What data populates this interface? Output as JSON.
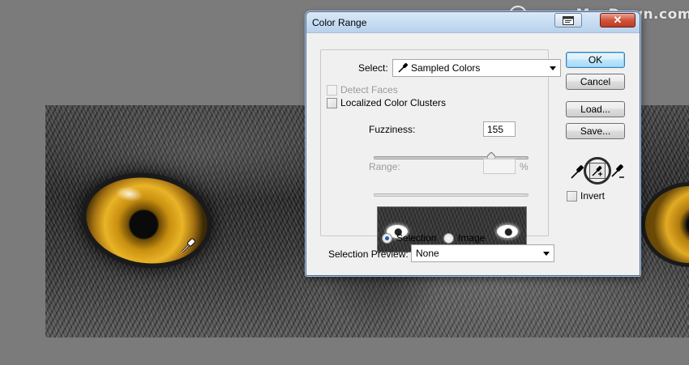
{
  "watermark": {
    "logo": "M",
    "text": "www.MacDown.com"
  },
  "dialog": {
    "title": "Color Range",
    "select": {
      "label": "Select:",
      "value": "Sampled Colors"
    },
    "detect_faces": {
      "label": "Detect Faces",
      "checked": false,
      "enabled": false
    },
    "localized_clusters": {
      "label": "Localized Color Clusters",
      "checked": false
    },
    "fuzziness": {
      "label": "Fuzziness:",
      "value": "155",
      "slider_fraction": 0.76
    },
    "range": {
      "label": "Range:",
      "value": "",
      "unit": "%",
      "enabled": false
    },
    "view": {
      "options": [
        "Selection",
        "Image"
      ],
      "selected": "Selection"
    },
    "selection_preview": {
      "label": "Selection Preview:",
      "value": "None"
    },
    "buttons": {
      "ok": "OK",
      "cancel": "Cancel",
      "load": "Load...",
      "save": "Save..."
    },
    "invert": {
      "label": "Invert",
      "checked": false
    },
    "tools": [
      "eyedropper-icon",
      "eyedropper-plus-icon",
      "eyedropper-minus-icon"
    ],
    "active_tool": "eyedropper-plus-icon"
  },
  "colors": {
    "titlebar": "#c6dcf2",
    "close_button": "#c13a22",
    "default_button": "#bee6fd",
    "eye": "#e9b427"
  }
}
